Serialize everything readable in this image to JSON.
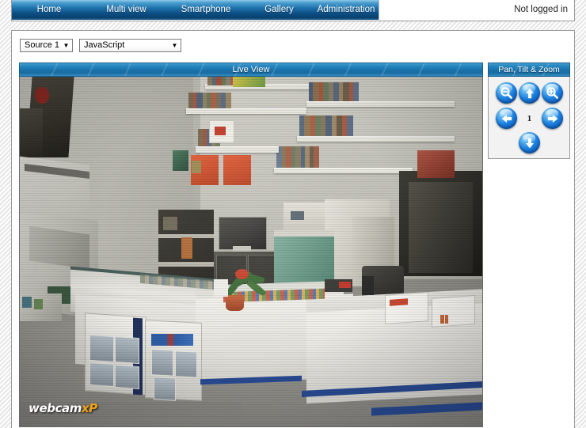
{
  "header": {
    "nav": [
      {
        "id": "home",
        "label": "Home"
      },
      {
        "id": "multiview",
        "label": "Multi view"
      },
      {
        "id": "smartphone",
        "label": "Smartphone"
      },
      {
        "id": "gallery",
        "label": "Gallery"
      },
      {
        "id": "admin",
        "label": "Administration"
      }
    ],
    "login_status": "Not logged in"
  },
  "controls": {
    "source_select": {
      "value": "Source 1",
      "arrow": "▼",
      "options": [
        "Source 1"
      ]
    },
    "mode_select": {
      "value": "JavaScript",
      "arrow": "▼",
      "options": [
        "JavaScript"
      ]
    }
  },
  "live_view": {
    "title": "Live View",
    "watermark_main": "webcam",
    "watermark_accent": "xP"
  },
  "ptz": {
    "title": "Pan, Tilt & Zoom",
    "position": "1",
    "buttons": [
      {
        "id": "zoom-out",
        "name": "zoom-out-icon"
      },
      {
        "id": "up",
        "name": "arrow-up-icon"
      },
      {
        "id": "zoom-in",
        "name": "zoom-in-icon"
      },
      {
        "id": "left",
        "name": "arrow-left-icon"
      },
      {
        "id": "right",
        "name": "arrow-right-icon"
      },
      {
        "id": "down",
        "name": "arrow-down-icon"
      }
    ]
  },
  "colors": {
    "nav_gradient_top": "#8fc7e8",
    "nav_gradient_bottom": "#0a3f6c",
    "panel_header_blue": "#1a73ac",
    "ptz_button_blue": "#1b7fe0",
    "watermark_accent": "#f0a21b"
  }
}
